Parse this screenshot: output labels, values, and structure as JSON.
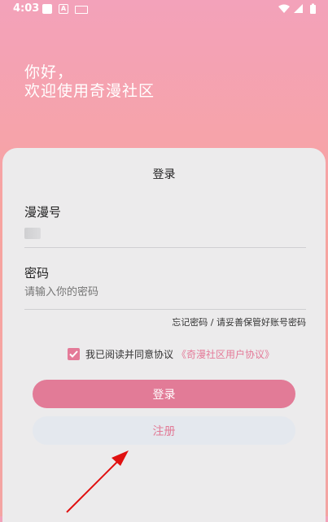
{
  "status_bar": {
    "time": "4:03",
    "icons": [
      "notification-square-icon",
      "a-icon",
      "keyboard-icon",
      "wifi-icon",
      "signal-icon",
      "battery-icon"
    ]
  },
  "greeting": {
    "line1": "你好，",
    "line2": "欢迎使用奇漫社区"
  },
  "card": {
    "title": "登录",
    "account_label": "漫漫号",
    "password_label": "密码",
    "password_placeholder": "请输入你的密码",
    "forgot_text": "忘记密码 / 请妥善保管好账号密码",
    "agree_text": "我已阅读并同意协议",
    "agree_link": "《奇漫社区用户协议》",
    "agree_checked": true,
    "login_button": "登录",
    "register_button": "注册"
  },
  "colors": {
    "accent": "#e27b97",
    "header_top": "#f3a2ba",
    "header_bottom": "#f7a3a0",
    "card_bg": "#ecebec",
    "annotation_arrow": "#e01010"
  }
}
